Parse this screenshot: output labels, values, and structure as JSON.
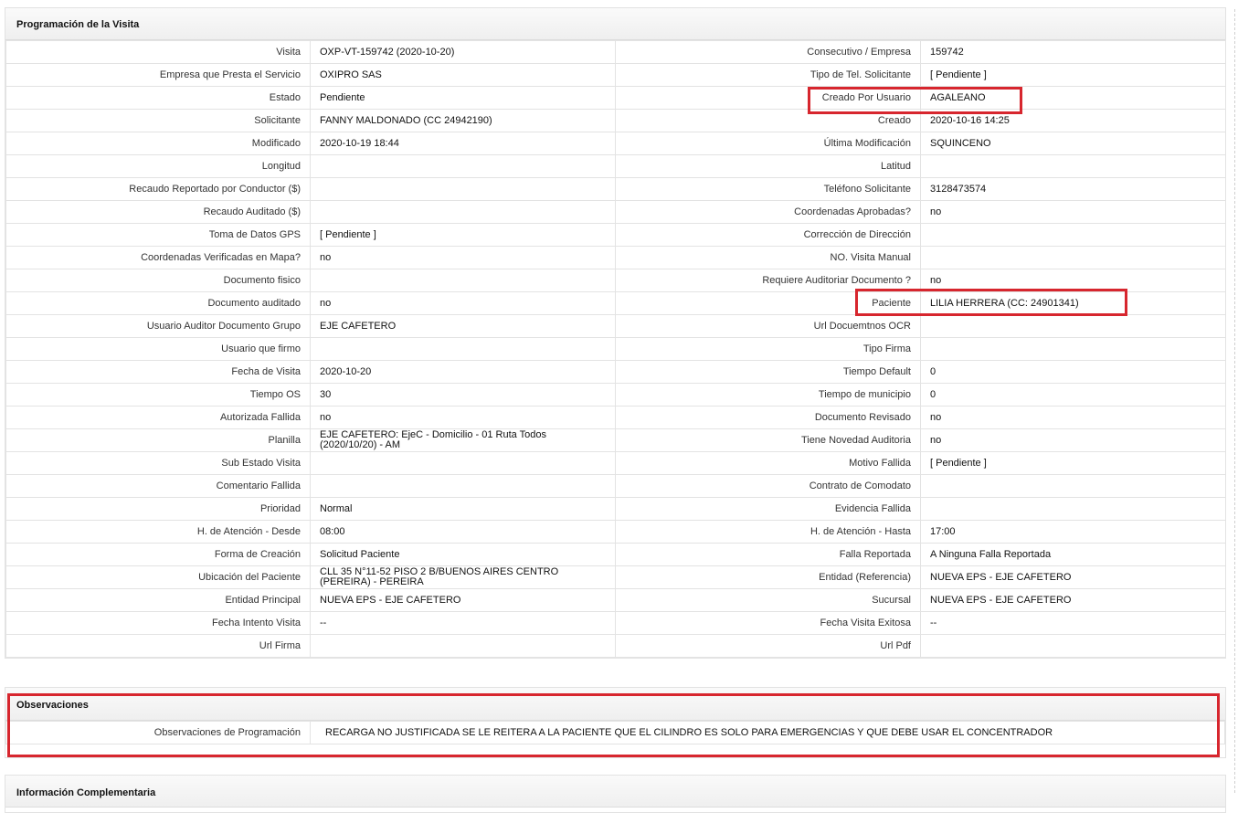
{
  "section_programacion": {
    "title": "Programación de la Visita",
    "rows": [
      {
        "l1": "Visita",
        "v1": "OXP-VT-159742 (2020-10-20)",
        "l2": "Consecutivo / Empresa",
        "v2": "159742"
      },
      {
        "l1": "Empresa que Presta el Servicio",
        "v1": "OXIPRO SAS",
        "l2": "Tipo de Tel. Solicitante",
        "v2": "[ Pendiente ]"
      },
      {
        "l1": "Estado",
        "v1": "Pendiente",
        "l2": "Creado Por Usuario",
        "v2": "AGALEANO"
      },
      {
        "l1": "Solicitante",
        "v1": "FANNY MALDONADO (CC 24942190)",
        "l2": "Creado",
        "v2": "2020-10-16 14:25"
      },
      {
        "l1": "Modificado",
        "v1": "2020-10-19 18:44",
        "l2": "Última Modificación",
        "v2": " SQUINCENO"
      },
      {
        "l1": "Longitud",
        "v1": "",
        "l2": "Latitud",
        "v2": ""
      },
      {
        "l1": "Recaudo Reportado por Conductor ($)",
        "v1": "",
        "l2": "Teléfono Solicitante",
        "v2": "3128473574"
      },
      {
        "l1": "Recaudo Auditado ($)",
        "v1": "",
        "l2": "Coordenadas Aprobadas?",
        "v2": " no"
      },
      {
        "l1": "Toma de Datos GPS",
        "v1": "[ Pendiente ]",
        "l2": "Corrección de Dirección",
        "v2": ""
      },
      {
        "l1": "Coordenadas Verificadas en Mapa?",
        "v1": " no",
        "l2": "NO. Visita Manual",
        "v2": ""
      },
      {
        "l1": "Documento fisico",
        "v1": "",
        "l2": "Requiere Auditoriar Documento ?",
        "v2": " no"
      },
      {
        "l1": "Documento auditado",
        "v1": "no",
        "l2": "Paciente",
        "v2": "LILIA HERRERA (CC: 24901341)"
      },
      {
        "l1": "Usuario Auditor Documento Grupo",
        "v1": "EJE CAFETERO",
        "l2": "Url Docuemtnos OCR",
        "v2": ""
      },
      {
        "l1": "Usuario que firmo",
        "v1": "",
        "l2": "Tipo Firma",
        "v2": ""
      },
      {
        "l1": "Fecha de Visita",
        "v1": " 2020-10-20",
        "l2": "Tiempo Default",
        "v2": "0"
      },
      {
        "l1": "Tiempo OS",
        "v1": "30",
        "l2": "Tiempo de municipio",
        "v2": "0"
      },
      {
        "l1": "Autorizada Fallida",
        "v1": "no",
        "l2": "Documento Revisado",
        "v2": " no"
      },
      {
        "l1": "Planilla",
        "v1": "EJE CAFETERO: EjeC - Domicilio - 01 Ruta Todos (2020/10/20) - AM",
        "l2": "Tiene Novedad Auditoria",
        "v2": " no"
      },
      {
        "l1": "Sub Estado Visita",
        "v1": "",
        "l2": "Motivo Fallida",
        "v2": "[ Pendiente ]"
      },
      {
        "l1": "Comentario Fallida",
        "v1": "",
        "l2": "Contrato de Comodato",
        "v2": ""
      },
      {
        "l1": "Prioridad",
        "v1": "Normal",
        "l2": "Evidencia Fallida",
        "v2": ""
      },
      {
        "l1": "H. de Atención - Desde",
        "v1": "08:00",
        "l2": "H. de Atención - Hasta",
        "v2": "17:00"
      },
      {
        "l1": "Forma de Creación",
        "v1": "Solicitud Paciente",
        "l2": "Falla Reportada",
        "v2": "A Ninguna Falla Reportada"
      },
      {
        "l1": "Ubicación del Paciente",
        "v1": "CLL 35 N°11-52 PISO 2 B/BUENOS AIRES CENTRO (PEREIRA) - PEREIRA",
        "l2": "Entidad (Referencia)",
        "v2": "NUEVA EPS - EJE CAFETERO"
      },
      {
        "l1": "Entidad Principal",
        "v1": "NUEVA EPS - EJE CAFETERO",
        "l2": "Sucursal",
        "v2": "NUEVA EPS - EJE CAFETERO"
      },
      {
        "l1": "Fecha Intento Visita",
        "v1": " --",
        "l2": "Fecha Visita Exitosa",
        "v2": " --"
      },
      {
        "l1": "Url Firma",
        "v1": "",
        "l2": "Url Pdf",
        "v2": ""
      }
    ]
  },
  "section_observaciones": {
    "title": "Observaciones",
    "label": "Observaciones de Programación",
    "value": "RECARGA NO JUSTIFICADA SE LE REITERA A LA PACIENTE QUE EL CILINDRO ES SOLO PARA EMERGENCIAS Y QUE DEBE USAR EL CONCENTRADOR"
  },
  "section_complementaria": {
    "title": "Información Complementaria"
  },
  "colors": {
    "highlight": "#d7262e",
    "border": "#e3e3e3"
  }
}
